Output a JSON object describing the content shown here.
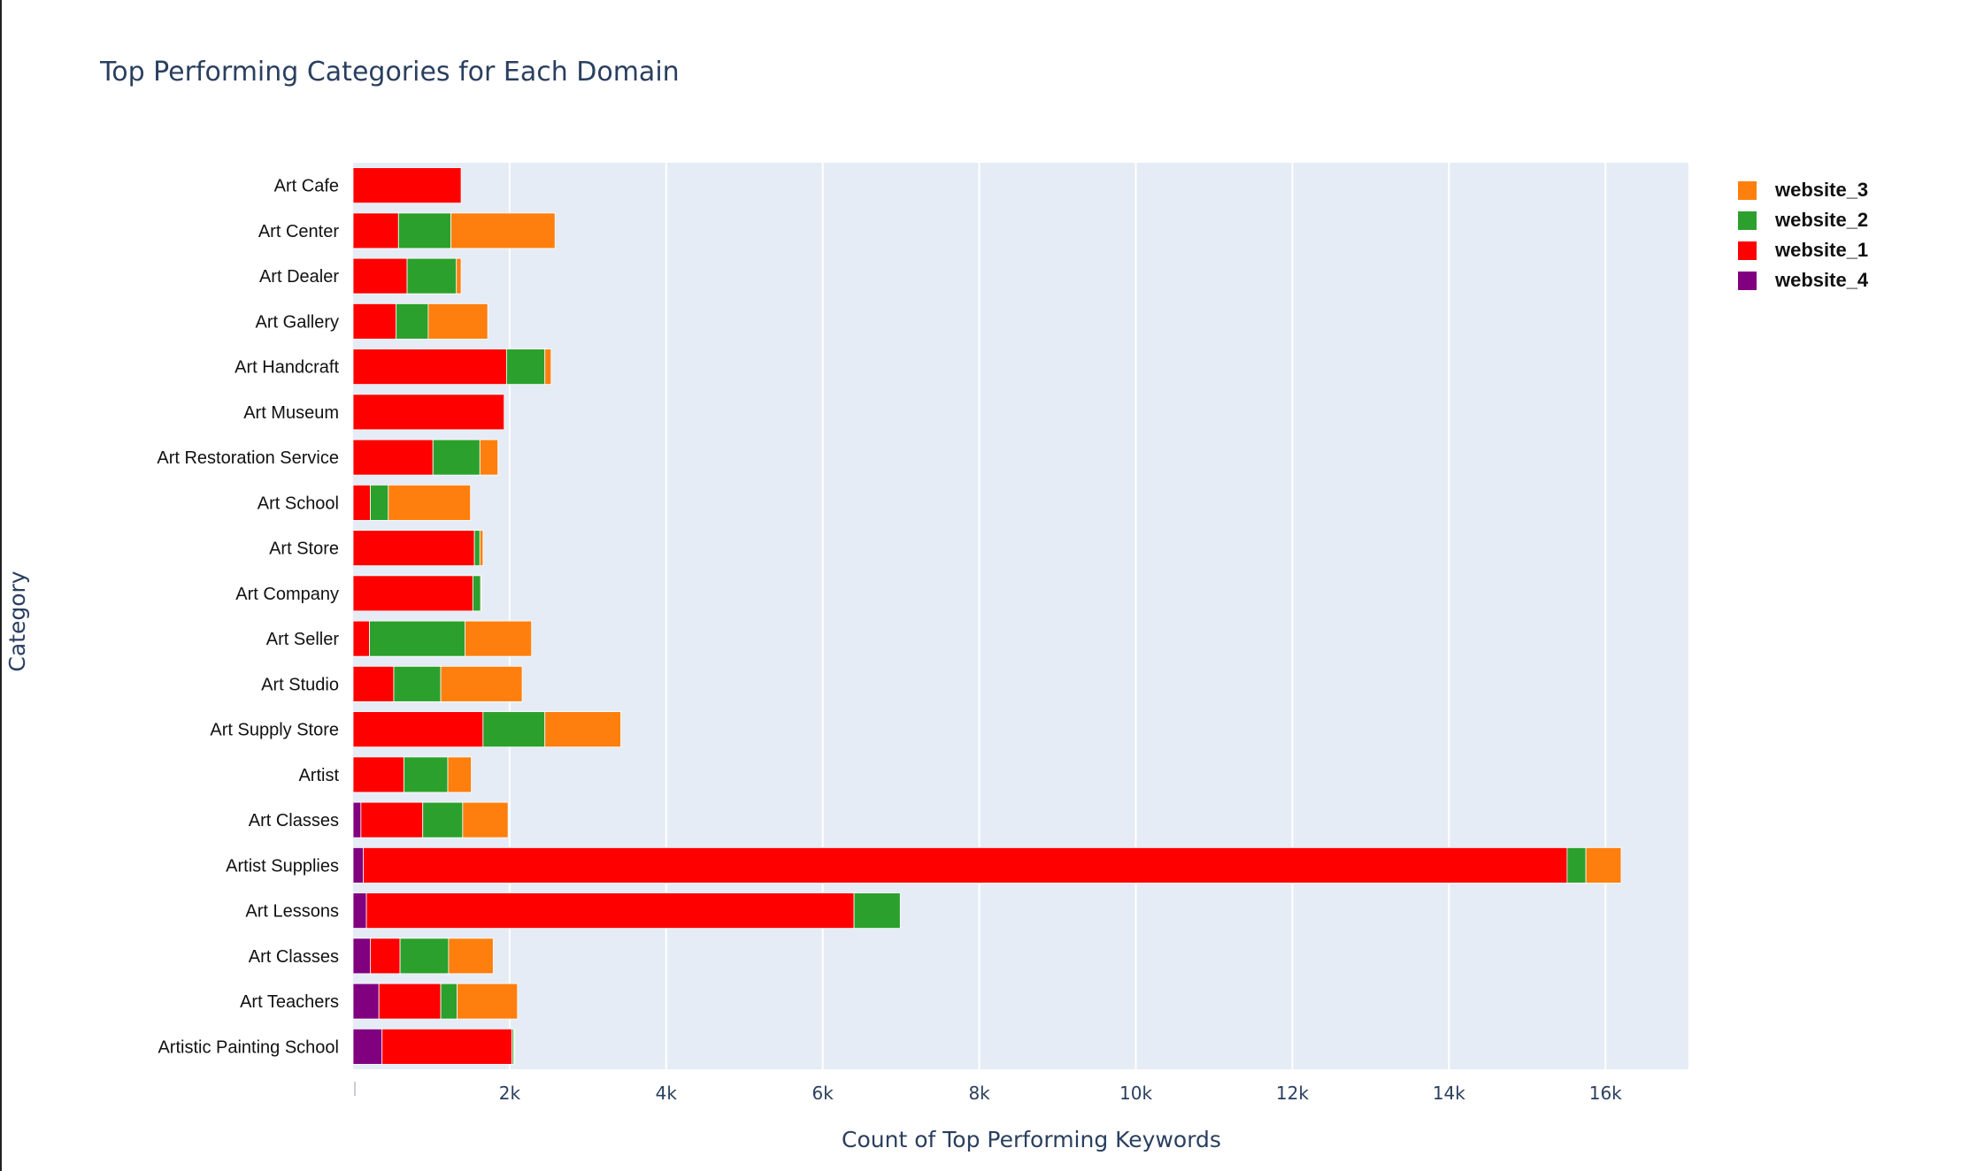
{
  "chart_data": {
    "type": "bar",
    "orientation": "horizontal",
    "barmode": "stack",
    "title": "Top Performing Categories for Each Domain",
    "xlabel": "Count of Top Performing Keywords",
    "ylabel": "Category",
    "xlim": [
      0,
      17060
    ],
    "x_ticks": [
      0,
      2000,
      4000,
      6000,
      8000,
      10000,
      12000,
      14000,
      16000
    ],
    "x_tick_labels": [
      "",
      "2k",
      "4k",
      "6k",
      "8k",
      "10k",
      "12k",
      "14k",
      "16k"
    ],
    "grid": true,
    "legend_position": "top-right",
    "categories": [
      "Art Cafe",
      "Art Center",
      "Art Dealer",
      "Art Gallery",
      "Art Handcraft",
      "Art Museum",
      "Art Restoration Service",
      "Art School",
      "Art Store",
      "Art Company",
      "Art Seller",
      "Art Studio",
      "Art Supply Store",
      "Artist",
      "Art Classes",
      "Artist Supplies",
      "Art Lessons",
      "Art Classes",
      "Art Teachers",
      "Artistic Painting School"
    ],
    "series": [
      {
        "name": "website_4",
        "color": "#800080",
        "values": [
          0,
          0,
          0,
          0,
          0,
          0,
          0,
          0,
          0,
          0,
          0,
          0,
          0,
          0,
          100,
          130,
          170,
          220,
          330,
          370
        ]
      },
      {
        "name": "website_1",
        "color": "#ff0000",
        "values": [
          1380,
          580,
          690,
          550,
          1960,
          1930,
          1020,
          220,
          1550,
          1530,
          210,
          520,
          1660,
          650,
          790,
          15380,
          6230,
          380,
          790,
          1660
        ]
      },
      {
        "name": "website_2",
        "color": "#2ca02c",
        "values": [
          0,
          670,
          630,
          410,
          490,
          0,
          600,
          230,
          70,
          100,
          1220,
          600,
          790,
          560,
          510,
          240,
          590,
          620,
          210,
          20
        ]
      },
      {
        "name": "website_3",
        "color": "#ff7f0e",
        "values": [
          0,
          1330,
          60,
          760,
          80,
          0,
          230,
          1050,
          40,
          10,
          850,
          1040,
          970,
          300,
          580,
          450,
          0,
          570,
          770,
          10
        ]
      }
    ],
    "legend_order": [
      "website_3",
      "website_2",
      "website_1",
      "website_4"
    ]
  },
  "colors": {
    "plot_background": "#e5ecf6",
    "grid": "#ffffff",
    "axis_text": "#2a3f5f"
  }
}
